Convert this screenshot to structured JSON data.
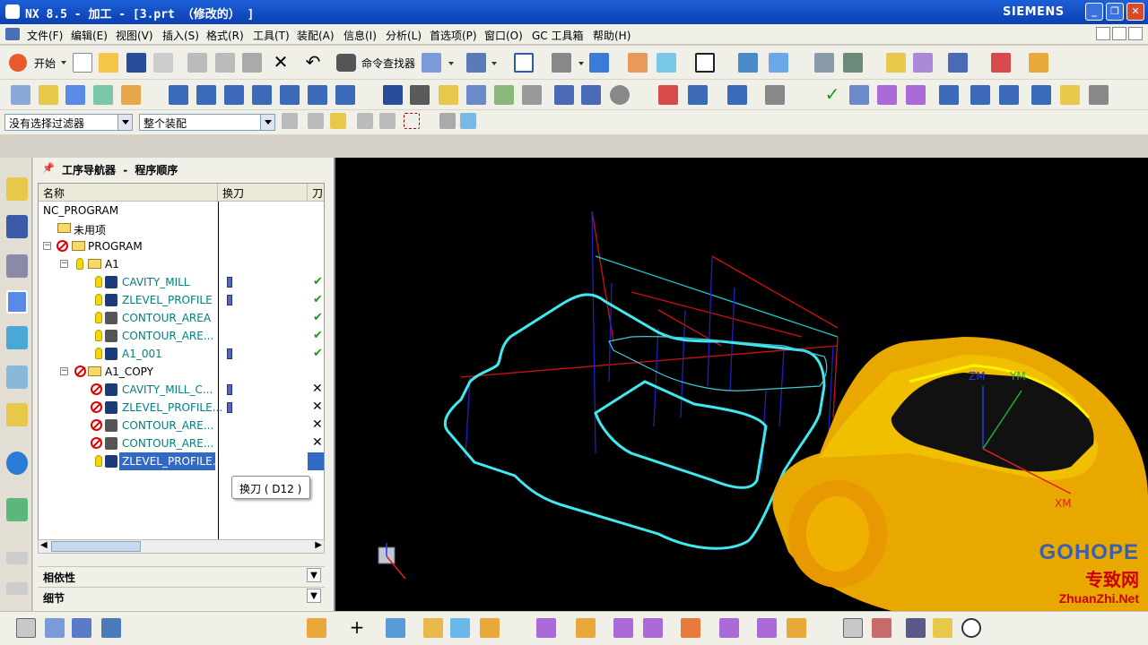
{
  "titlebar": {
    "title": "NX 8.5 - 加工 - [3.prt （修改的） ]",
    "brand": "SIEMENS"
  },
  "menu": [
    "文件(F)",
    "编辑(E)",
    "视图(V)",
    "插入(S)",
    "格式(R)",
    "工具(T)",
    "装配(A)",
    "信息(I)",
    "分析(L)",
    "首选项(P)",
    "窗口(O)",
    "GC 工具箱",
    "帮助(H)"
  ],
  "toolbar": {
    "start_label": "开始",
    "cmd_finder_label": "命令查找器"
  },
  "filters": {
    "selection_filter": "没有选择过滤器",
    "scope": "整个装配"
  },
  "navigator": {
    "title_prefix": "工序导航器",
    "title_sep": "-",
    "title_suffix": "程序顺序",
    "columns": [
      "名称",
      "换刀",
      "刀"
    ],
    "rows": [
      {
        "name": "NC_PROGRAM"
      },
      {
        "name": "未用项"
      },
      {
        "name": "PROGRAM"
      },
      {
        "name": "A1"
      },
      {
        "name": "CAVITY_MILL"
      },
      {
        "name": "ZLEVEL_PROFILE"
      },
      {
        "name": "CONTOUR_AREA"
      },
      {
        "name": "CONTOUR_ARE..."
      },
      {
        "name": "A1_001"
      },
      {
        "name": "A1_COPY"
      },
      {
        "name": "CAVITY_MILL_C..."
      },
      {
        "name": "ZLEVEL_PROFILE..."
      },
      {
        "name": "CONTOUR_ARE..."
      },
      {
        "name": "CONTOUR_ARE..."
      },
      {
        "name": "ZLEVEL_PROFILE..."
      }
    ],
    "tooltip": "换刀 ( D12 )",
    "panels": [
      "相依性",
      "细节"
    ]
  },
  "viewport": {
    "axis_labels": {
      "zm": "ZM",
      "ym": "YM",
      "xm": "XM"
    }
  },
  "watermark": {
    "brand": "GOHOPE",
    "site": "ZhuanZhi.Net",
    "cn": "专致网"
  }
}
